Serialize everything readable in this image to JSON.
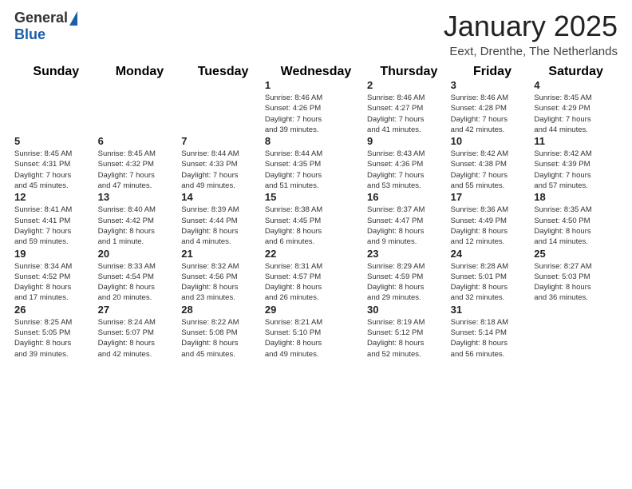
{
  "header": {
    "logo_general": "General",
    "logo_blue": "Blue",
    "month_year": "January 2025",
    "location": "Eext, Drenthe, The Netherlands"
  },
  "calendar": {
    "days_of_week": [
      "Sunday",
      "Monday",
      "Tuesday",
      "Wednesday",
      "Thursday",
      "Friday",
      "Saturday"
    ],
    "weeks": [
      [
        {
          "day": "",
          "info": ""
        },
        {
          "day": "",
          "info": ""
        },
        {
          "day": "",
          "info": ""
        },
        {
          "day": "1",
          "info": "Sunrise: 8:46 AM\nSunset: 4:26 PM\nDaylight: 7 hours\nand 39 minutes."
        },
        {
          "day": "2",
          "info": "Sunrise: 8:46 AM\nSunset: 4:27 PM\nDaylight: 7 hours\nand 41 minutes."
        },
        {
          "day": "3",
          "info": "Sunrise: 8:46 AM\nSunset: 4:28 PM\nDaylight: 7 hours\nand 42 minutes."
        },
        {
          "day": "4",
          "info": "Sunrise: 8:45 AM\nSunset: 4:29 PM\nDaylight: 7 hours\nand 44 minutes."
        }
      ],
      [
        {
          "day": "5",
          "info": "Sunrise: 8:45 AM\nSunset: 4:31 PM\nDaylight: 7 hours\nand 45 minutes."
        },
        {
          "day": "6",
          "info": "Sunrise: 8:45 AM\nSunset: 4:32 PM\nDaylight: 7 hours\nand 47 minutes."
        },
        {
          "day": "7",
          "info": "Sunrise: 8:44 AM\nSunset: 4:33 PM\nDaylight: 7 hours\nand 49 minutes."
        },
        {
          "day": "8",
          "info": "Sunrise: 8:44 AM\nSunset: 4:35 PM\nDaylight: 7 hours\nand 51 minutes."
        },
        {
          "day": "9",
          "info": "Sunrise: 8:43 AM\nSunset: 4:36 PM\nDaylight: 7 hours\nand 53 minutes."
        },
        {
          "day": "10",
          "info": "Sunrise: 8:42 AM\nSunset: 4:38 PM\nDaylight: 7 hours\nand 55 minutes."
        },
        {
          "day": "11",
          "info": "Sunrise: 8:42 AM\nSunset: 4:39 PM\nDaylight: 7 hours\nand 57 minutes."
        }
      ],
      [
        {
          "day": "12",
          "info": "Sunrise: 8:41 AM\nSunset: 4:41 PM\nDaylight: 7 hours\nand 59 minutes."
        },
        {
          "day": "13",
          "info": "Sunrise: 8:40 AM\nSunset: 4:42 PM\nDaylight: 8 hours\nand 1 minute."
        },
        {
          "day": "14",
          "info": "Sunrise: 8:39 AM\nSunset: 4:44 PM\nDaylight: 8 hours\nand 4 minutes."
        },
        {
          "day": "15",
          "info": "Sunrise: 8:38 AM\nSunset: 4:45 PM\nDaylight: 8 hours\nand 6 minutes."
        },
        {
          "day": "16",
          "info": "Sunrise: 8:37 AM\nSunset: 4:47 PM\nDaylight: 8 hours\nand 9 minutes."
        },
        {
          "day": "17",
          "info": "Sunrise: 8:36 AM\nSunset: 4:49 PM\nDaylight: 8 hours\nand 12 minutes."
        },
        {
          "day": "18",
          "info": "Sunrise: 8:35 AM\nSunset: 4:50 PM\nDaylight: 8 hours\nand 14 minutes."
        }
      ],
      [
        {
          "day": "19",
          "info": "Sunrise: 8:34 AM\nSunset: 4:52 PM\nDaylight: 8 hours\nand 17 minutes."
        },
        {
          "day": "20",
          "info": "Sunrise: 8:33 AM\nSunset: 4:54 PM\nDaylight: 8 hours\nand 20 minutes."
        },
        {
          "day": "21",
          "info": "Sunrise: 8:32 AM\nSunset: 4:56 PM\nDaylight: 8 hours\nand 23 minutes."
        },
        {
          "day": "22",
          "info": "Sunrise: 8:31 AM\nSunset: 4:57 PM\nDaylight: 8 hours\nand 26 minutes."
        },
        {
          "day": "23",
          "info": "Sunrise: 8:29 AM\nSunset: 4:59 PM\nDaylight: 8 hours\nand 29 minutes."
        },
        {
          "day": "24",
          "info": "Sunrise: 8:28 AM\nSunset: 5:01 PM\nDaylight: 8 hours\nand 32 minutes."
        },
        {
          "day": "25",
          "info": "Sunrise: 8:27 AM\nSunset: 5:03 PM\nDaylight: 8 hours\nand 36 minutes."
        }
      ],
      [
        {
          "day": "26",
          "info": "Sunrise: 8:25 AM\nSunset: 5:05 PM\nDaylight: 8 hours\nand 39 minutes."
        },
        {
          "day": "27",
          "info": "Sunrise: 8:24 AM\nSunset: 5:07 PM\nDaylight: 8 hours\nand 42 minutes."
        },
        {
          "day": "28",
          "info": "Sunrise: 8:22 AM\nSunset: 5:08 PM\nDaylight: 8 hours\nand 45 minutes."
        },
        {
          "day": "29",
          "info": "Sunrise: 8:21 AM\nSunset: 5:10 PM\nDaylight: 8 hours\nand 49 minutes."
        },
        {
          "day": "30",
          "info": "Sunrise: 8:19 AM\nSunset: 5:12 PM\nDaylight: 8 hours\nand 52 minutes."
        },
        {
          "day": "31",
          "info": "Sunrise: 8:18 AM\nSunset: 5:14 PM\nDaylight: 8 hours\nand 56 minutes."
        },
        {
          "day": "",
          "info": ""
        }
      ]
    ]
  }
}
